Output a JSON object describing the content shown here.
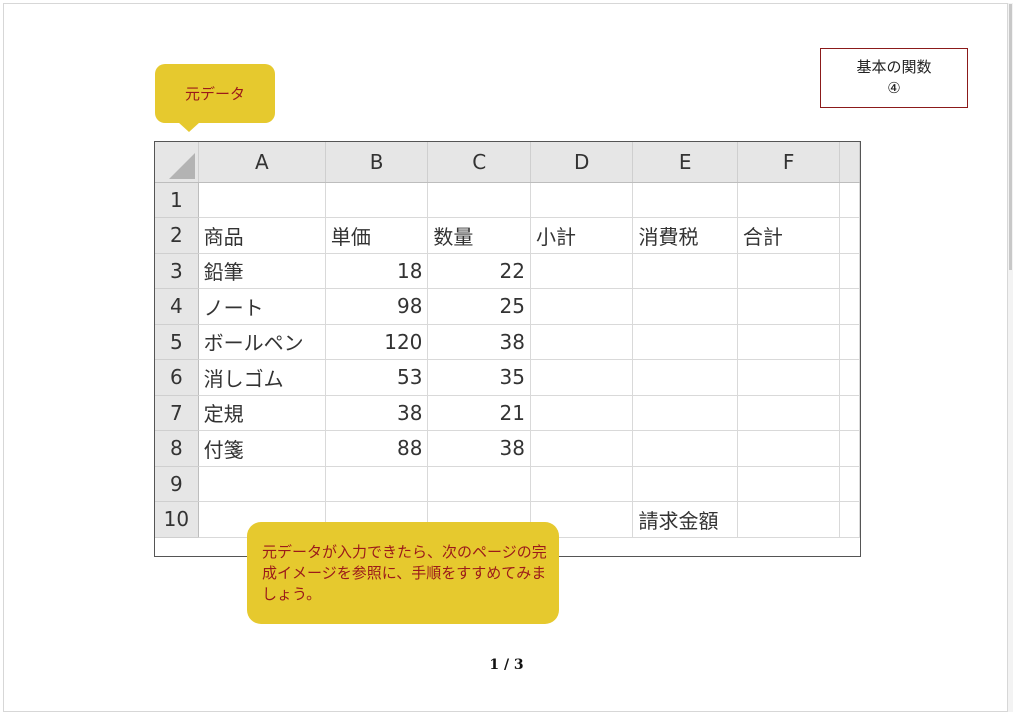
{
  "title_box": {
    "line1": "基本の関数",
    "line2": "④"
  },
  "callout_top": {
    "text": "元データ"
  },
  "callout_bottom": {
    "text": "元データが入力できたら、次のページの完成イメージを参照に、手順をすすめてみましょう。"
  },
  "sheet": {
    "columns": [
      "A",
      "B",
      "C",
      "D",
      "E",
      "F"
    ],
    "rows": [
      {
        "num": "1",
        "cells": [
          "",
          "",
          "",
          "",
          "",
          ""
        ]
      },
      {
        "num": "2",
        "cells": [
          "商品",
          "単価",
          "数量",
          "小計",
          "消費税",
          "合計"
        ]
      },
      {
        "num": "3",
        "cells": [
          "鉛筆",
          "18",
          "22",
          "",
          "",
          ""
        ]
      },
      {
        "num": "4",
        "cells": [
          "ノート",
          "98",
          "25",
          "",
          "",
          ""
        ]
      },
      {
        "num": "5",
        "cells": [
          "ボールペン",
          "120",
          "38",
          "",
          "",
          ""
        ]
      },
      {
        "num": "6",
        "cells": [
          "消しゴム",
          "53",
          "35",
          "",
          "",
          ""
        ]
      },
      {
        "num": "7",
        "cells": [
          "定規",
          "38",
          "21",
          "",
          "",
          ""
        ]
      },
      {
        "num": "8",
        "cells": [
          "付箋",
          "88",
          "38",
          "",
          "",
          ""
        ]
      },
      {
        "num": "9",
        "cells": [
          "",
          "",
          "",
          "",
          "",
          ""
        ]
      },
      {
        "num": "10",
        "cells": [
          "",
          "",
          "",
          "",
          "請求金額",
          ""
        ]
      }
    ]
  },
  "page_number": "1 / 3",
  "colors": {
    "callout": "#e6c92e",
    "callout_text": "#9b1a1a",
    "title_border": "#8b1a1a"
  }
}
